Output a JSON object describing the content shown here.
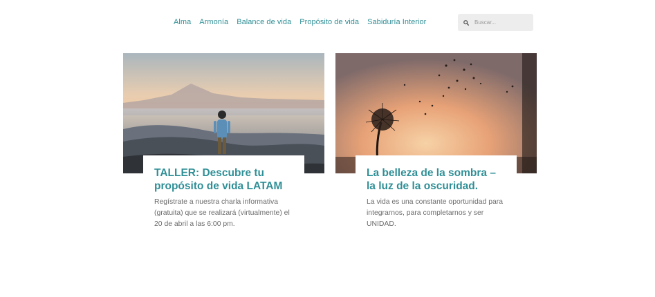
{
  "nav": {
    "items": [
      "Alma",
      "Armonía",
      "Balance de vida",
      "Propósito de vida",
      "Sabiduría Interior"
    ]
  },
  "search": {
    "placeholder": "Buscar..."
  },
  "posts": [
    {
      "title": "TALLER: Descubre tu propósito de vida LATAM",
      "excerpt": "Regístrate a nuestra charla informativa (gratuita) que se realizará (virtualmente) el 20 de abril a las 6:00 pm."
    },
    {
      "title": "La belleza de la sombra – la luz de la oscuridad.",
      "excerpt": "La vida es una constante oportunidad para integrarnos, para completarnos y ser UNIDAD."
    }
  ],
  "colors": {
    "accent": "#2f8f96",
    "text": "#6b6b6b",
    "search_bg": "#ededed"
  }
}
